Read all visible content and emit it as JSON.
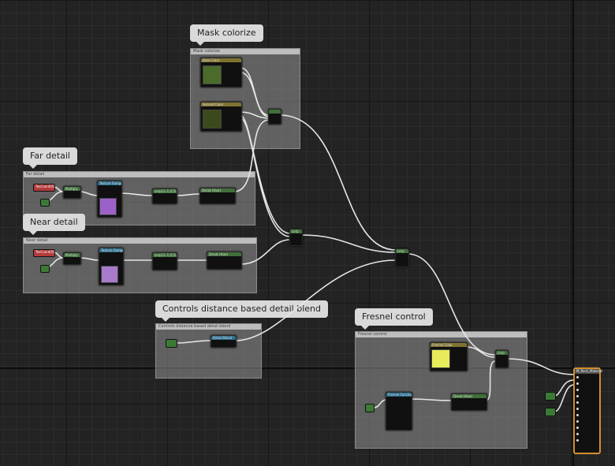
{
  "comments": {
    "mask": {
      "bubble": "Mask colorize",
      "bar": "Mask colorize"
    },
    "far": {
      "bubble": "Far detail",
      "bar": "Far detail"
    },
    "near": {
      "bubble": "Near detail",
      "bar": "Near detail"
    },
    "blend": {
      "bubble": "Controls distance based detail blend",
      "bar": "Controls distance based detail blend"
    },
    "fresnel": {
      "bubble": "Fresnel control",
      "bar": "Fresnel control"
    }
  },
  "nodes": {
    "base_color": "Base Color",
    "second_color": "Second Color",
    "texcoord": "TexCoord[0]",
    "multiply": "Multiply",
    "texture_sample": "Texture Sample",
    "linear_interpolate": "Lerp(3,-1,0,5)",
    "desaturation": "Desat (Hue)",
    "fresnel_color": "Fresnel Color",
    "lerp": "Lerp",
    "fresnel_function": "Fresnel Function",
    "detail_blend": "Detail Blend",
    "result": "M_Rock_Material"
  },
  "colors": {
    "swatch_base": "#4b6b2a",
    "swatch_second": "#3b4a1a",
    "swatch_far": "#9a62c8",
    "swatch_near": "#a77acb",
    "swatch_fresnel": "#e7ec5a",
    "wire": "#e6e6e6",
    "result_border": "#d08f2a"
  }
}
